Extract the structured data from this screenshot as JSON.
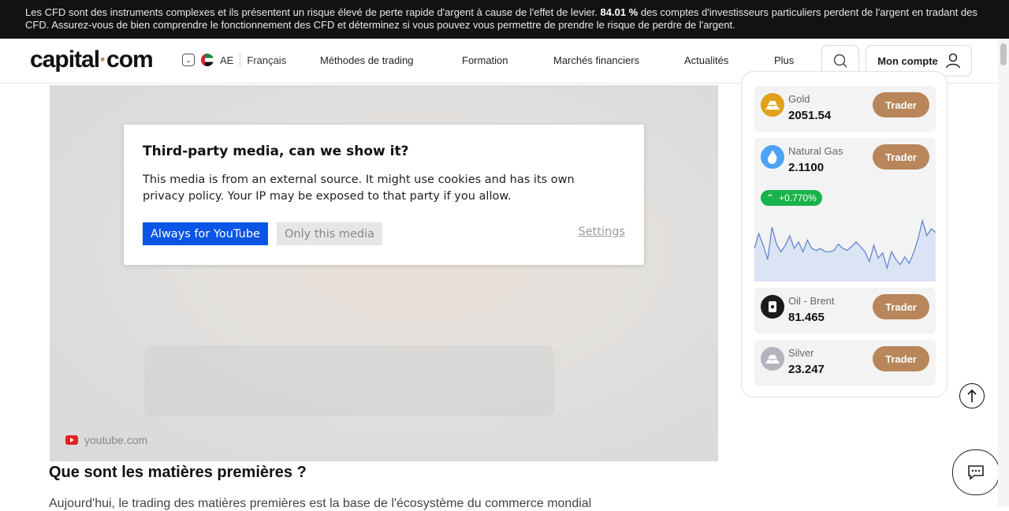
{
  "risk_banner": {
    "text_before": "Les CFD sont des instruments complexes et ils présentent un risque élevé de perte rapide d'argent à cause de l'effet de levier. ",
    "percent": "84.01 %",
    "text_after": " des comptes d'investisseurs particuliers perdent de l'argent en tradant des CFD. Assurez-vous de bien comprendre le fonctionnement des CFD et déterminez si vous pouvez vous permettre de prendre le risque de perdre de l'argent."
  },
  "header": {
    "logo_left": "capital",
    "logo_dot": "·",
    "logo_right": "com",
    "region_code": "AE",
    "language": "Français",
    "nav": [
      "Méthodes de trading",
      "Formation",
      "Marchés financiers",
      "Actualités",
      "Plus"
    ],
    "account_label": "Mon compte"
  },
  "video": {
    "consent_title": "Third-party media, can we show it?",
    "consent_text": "This media is from an external source. It might use cookies and has its own privacy policy. Your IP may be exposed to that party if you allow.",
    "always_label": "Always for YouTube",
    "only_label": "Only this media",
    "settings_label": "Settings",
    "source": "youtube.com"
  },
  "article": {
    "heading": "Que sont les matières premières ?",
    "paragraph": "Aujourd'hui, le trading des matières premières est la base de l'écosystème du commerce mondial"
  },
  "markets": {
    "trade_label": "Trader",
    "items": [
      {
        "name": "Gold",
        "price": "2051.54",
        "icon": "gold-bars-icon",
        "color": "#e0a11b"
      },
      {
        "name": "Natural Gas",
        "price": "2.1100",
        "icon": "flame-icon",
        "color": "#4da3f5",
        "change": "+0.770%"
      },
      {
        "name": "Oil - Brent",
        "price": "81.465",
        "icon": "oil-barrel-icon",
        "color": "#1b1b1b"
      },
      {
        "name": "Silver",
        "price": "23.247",
        "icon": "silver-bars-icon",
        "color": "#b3b3bd"
      }
    ],
    "sparkline": [
      0.55,
      0.32,
      0.5,
      0.72,
      0.22,
      0.48,
      0.6,
      0.5,
      0.35,
      0.55,
      0.45,
      0.6,
      0.42,
      0.55,
      0.58,
      0.55,
      0.6,
      0.6,
      0.58,
      0.48,
      0.55,
      0.58,
      0.52,
      0.45,
      0.52,
      0.6,
      0.75,
      0.5,
      0.7,
      0.62,
      0.85,
      0.6,
      0.72,
      0.8,
      0.68,
      0.78,
      0.62,
      0.4,
      0.12,
      0.35,
      0.25,
      0.3
    ]
  }
}
